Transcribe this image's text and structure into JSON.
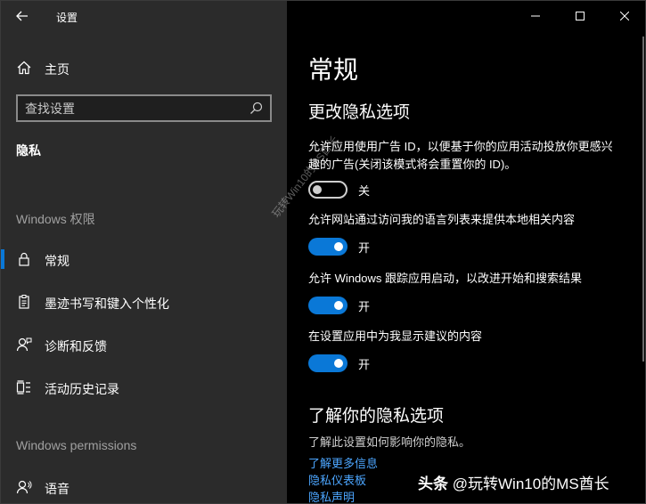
{
  "window": {
    "title": "设置"
  },
  "sidebar": {
    "home_label": "主页",
    "search": {
      "placeholder": "查找设置"
    },
    "current_section": "隐私",
    "groups": [
      {
        "header": "Windows 权限",
        "items": [
          {
            "label": "常规",
            "icon": "lock-icon",
            "active": true
          },
          {
            "label": "墨迹书写和键入个性化",
            "icon": "clipboard-icon",
            "active": false
          },
          {
            "label": "诊断和反馈",
            "icon": "person-feedback-icon",
            "active": false
          },
          {
            "label": "活动历史记录",
            "icon": "timeline-icon",
            "active": false
          }
        ]
      },
      {
        "header": "Windows permissions",
        "items": [
          {
            "label": "语音",
            "icon": "person-voice-icon",
            "active": false
          }
        ]
      }
    ]
  },
  "main": {
    "title": "常规",
    "section_heading": "更改隐私选项",
    "settings": [
      {
        "text": "允许应用使用广告 ID，以便基于你的应用活动投放你更感兴趣的广告(关闭该模式将会重置你的 ID)。",
        "state": "关",
        "on": false
      },
      {
        "text": "允许网站通过访问我的语言列表来提供本地相关内容",
        "state": "开",
        "on": true
      },
      {
        "text": "允许 Windows 跟踪应用启动，以改进开始和搜索结果",
        "state": "开",
        "on": true
      },
      {
        "text": "在设置应用中为我显示建议的内容",
        "state": "开",
        "on": true
      }
    ],
    "learn_heading": "了解你的隐私选项",
    "learn_text": "了解此设置如何影响你的隐私。",
    "links": [
      "了解更多信息",
      "隐私仪表板",
      "隐私声明"
    ]
  },
  "watermarks": {
    "diagonal": "玩转Win10的MS酋长",
    "badge_brand": "头条",
    "badge_handle": "@玩转Win10的MS酋长"
  },
  "colors": {
    "accent": "#0a78d7",
    "link": "#4ca6ff",
    "sidebar_bg": "#2b2b2b",
    "content_bg": "#000000"
  }
}
